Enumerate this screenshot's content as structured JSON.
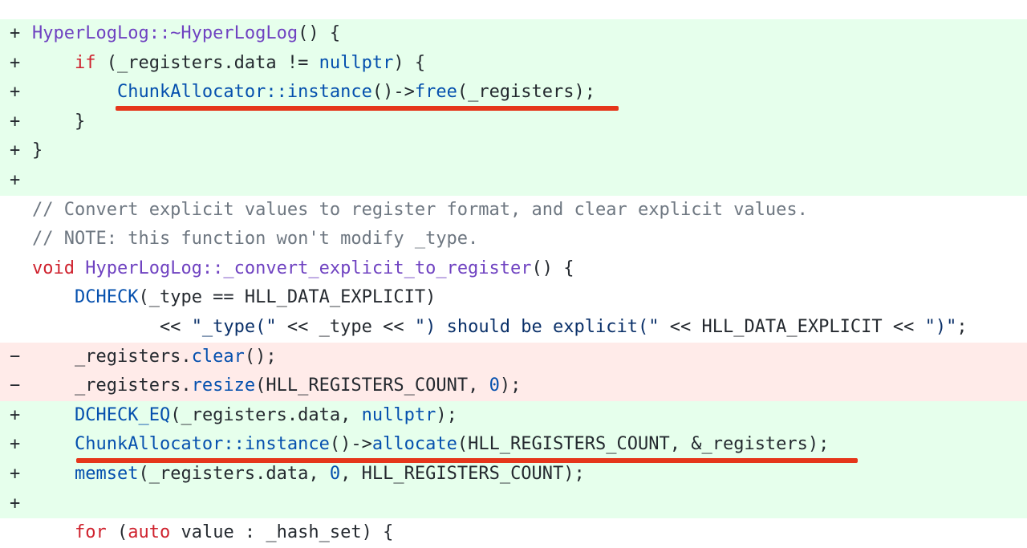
{
  "colors": {
    "added_bg": "#e6ffec",
    "removed_bg": "#ffebe9",
    "annotation_underline": "#e5361b"
  },
  "lines": [
    {
      "type": "add",
      "marker": "+",
      "tokens": [
        {
          "c": "fn",
          "t": "HyperLogLog::~HyperLogLog"
        },
        {
          "c": "plain",
          "t": "() {"
        }
      ]
    },
    {
      "type": "add",
      "marker": "+",
      "tokens": [
        {
          "c": "plain",
          "t": "    "
        },
        {
          "c": "kw",
          "t": "if"
        },
        {
          "c": "plain",
          "t": " (_registers.data != "
        },
        {
          "c": "blue",
          "t": "nullptr"
        },
        {
          "c": "plain",
          "t": ") {"
        }
      ]
    },
    {
      "type": "add",
      "marker": "+",
      "tokens": [
        {
          "c": "plain",
          "t": "        "
        },
        {
          "c": "blue",
          "t": "ChunkAllocator::instance"
        },
        {
          "c": "plain",
          "t": "()->"
        },
        {
          "c": "blue",
          "t": "free"
        },
        {
          "c": "plain",
          "t": "(_registers);"
        }
      ]
    },
    {
      "type": "add",
      "marker": "+",
      "tokens": [
        {
          "c": "plain",
          "t": "    }"
        }
      ]
    },
    {
      "type": "add",
      "marker": "+",
      "tokens": [
        {
          "c": "plain",
          "t": "}"
        }
      ]
    },
    {
      "type": "add",
      "marker": "+",
      "tokens": []
    },
    {
      "type": "ctx",
      "marker": "",
      "tokens": [
        {
          "c": "cm",
          "t": "// Convert explicit values to register format, and clear explicit values."
        }
      ]
    },
    {
      "type": "ctx",
      "marker": "",
      "tokens": [
        {
          "c": "cm",
          "t": "// NOTE: this function won't modify _type."
        }
      ]
    },
    {
      "type": "ctx",
      "marker": "",
      "tokens": [
        {
          "c": "kw",
          "t": "void"
        },
        {
          "c": "plain",
          "t": " "
        },
        {
          "c": "fn",
          "t": "HyperLogLog::_convert_explicit_to_register"
        },
        {
          "c": "plain",
          "t": "() {"
        }
      ]
    },
    {
      "type": "ctx",
      "marker": "",
      "tokens": [
        {
          "c": "plain",
          "t": "    "
        },
        {
          "c": "blue",
          "t": "DCHECK"
        },
        {
          "c": "plain",
          "t": "(_type == HLL_DATA_EXPLICIT)"
        }
      ]
    },
    {
      "type": "ctx",
      "marker": "",
      "tokens": [
        {
          "c": "plain",
          "t": "            << "
        },
        {
          "c": "str",
          "t": "\"_type(\""
        },
        {
          "c": "plain",
          "t": " << _type << "
        },
        {
          "c": "str",
          "t": "\") should be explicit(\""
        },
        {
          "c": "plain",
          "t": " << HLL_DATA_EXPLICIT << "
        },
        {
          "c": "str",
          "t": "\")\""
        },
        {
          "c": "plain",
          "t": ";"
        }
      ]
    },
    {
      "type": "del",
      "marker": "−",
      "tokens": [
        {
          "c": "plain",
          "t": "    _registers."
        },
        {
          "c": "blue",
          "t": "clear"
        },
        {
          "c": "plain",
          "t": "();"
        }
      ]
    },
    {
      "type": "del",
      "marker": "−",
      "tokens": [
        {
          "c": "plain",
          "t": "    _registers."
        },
        {
          "c": "blue",
          "t": "resize"
        },
        {
          "c": "plain",
          "t": "(HLL_REGISTERS_COUNT, "
        },
        {
          "c": "num",
          "t": "0"
        },
        {
          "c": "plain",
          "t": ");"
        }
      ]
    },
    {
      "type": "add",
      "marker": "+",
      "tokens": [
        {
          "c": "plain",
          "t": "    "
        },
        {
          "c": "blue",
          "t": "DCHECK_EQ"
        },
        {
          "c": "plain",
          "t": "(_registers.data, "
        },
        {
          "c": "blue",
          "t": "nullptr"
        },
        {
          "c": "plain",
          "t": ");"
        }
      ]
    },
    {
      "type": "add",
      "marker": "+",
      "tokens": [
        {
          "c": "plain",
          "t": "    "
        },
        {
          "c": "blue",
          "t": "ChunkAllocator::instance"
        },
        {
          "c": "plain",
          "t": "()->"
        },
        {
          "c": "blue",
          "t": "allocate"
        },
        {
          "c": "plain",
          "t": "(HLL_REGISTERS_COUNT, &_registers);"
        }
      ]
    },
    {
      "type": "add",
      "marker": "+",
      "tokens": [
        {
          "c": "plain",
          "t": "    "
        },
        {
          "c": "blue",
          "t": "memset"
        },
        {
          "c": "plain",
          "t": "(_registers.data, "
        },
        {
          "c": "num",
          "t": "0"
        },
        {
          "c": "plain",
          "t": ", HLL_REGISTERS_COUNT);"
        }
      ]
    },
    {
      "type": "add",
      "marker": "+",
      "tokens": []
    },
    {
      "type": "ctx",
      "marker": "",
      "tokens": [
        {
          "c": "plain",
          "t": "    "
        },
        {
          "c": "kw",
          "t": "for"
        },
        {
          "c": "plain",
          "t": " ("
        },
        {
          "c": "kw",
          "t": "auto"
        },
        {
          "c": "plain",
          "t": " value : _hash_set) {"
        }
      ]
    }
  ],
  "annotations": [
    {
      "line": 2,
      "label": "free-call-underline"
    },
    {
      "line": 14,
      "label": "allocate-call-underline"
    }
  ]
}
